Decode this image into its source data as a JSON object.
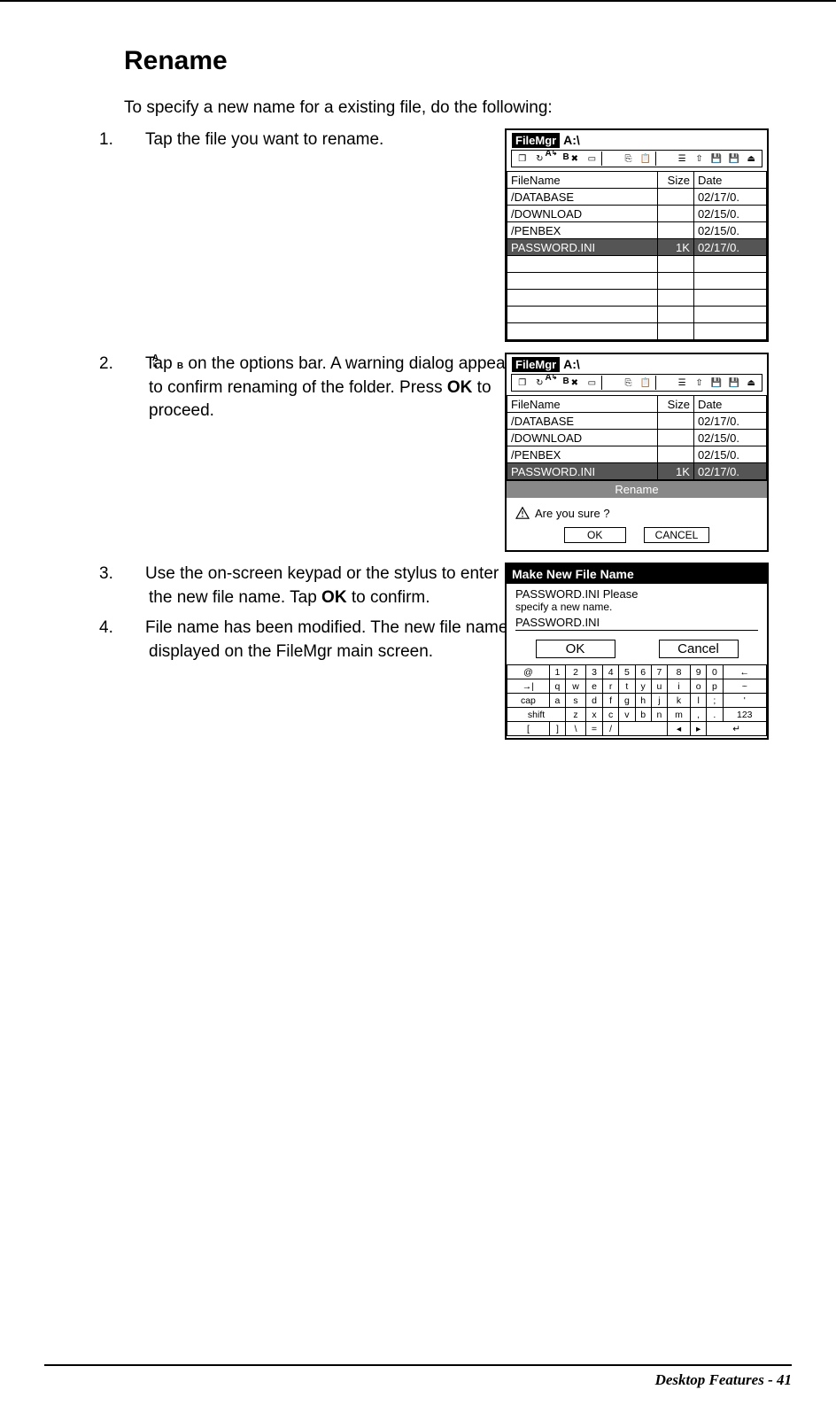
{
  "heading": "Rename",
  "intro": "To specify a new name for a existing file, do the following:",
  "steps": {
    "s1_num": "1.",
    "s1": "Tap the file you want to rename.",
    "s2_num": "2.",
    "s2_a": "Tap ",
    "s2_b": " on the options bar. A warning dialog appears to confirm renaming of the folder. Press ",
    "s2_ok": "OK",
    "s2_c": " to proceed.",
    "s3_num": "3.",
    "s3_a": "Use the on-screen keypad or the stylus to enter the new file name. Tap ",
    "s3_ok": "OK",
    "s3_b": " to con­firm.",
    "s4_num": "4.",
    "s4": "File name has been modified. The new file name is displayed on the FileMgr main screen."
  },
  "filemgr": {
    "title": "FileMgr",
    "path": "A:\\",
    "cols": {
      "name": "FileName",
      "size": "Size",
      "date": "Date"
    },
    "rows": [
      {
        "name": "/DATABASE",
        "size": "",
        "date": "02/17/0."
      },
      {
        "name": "/DOWNLOAD",
        "size": "",
        "date": "02/15/0."
      },
      {
        "name": "/PENBEX",
        "size": "",
        "date": "02/15/0."
      },
      {
        "name": "PASSWORD.INI",
        "size": "1K",
        "date": "02/17/0.",
        "selected": true
      }
    ]
  },
  "dialog": {
    "rename_label": "Rename",
    "msg": "Are you sure ?",
    "ok": "OK",
    "cancel": "CANCEL"
  },
  "makeNew": {
    "title": "Make New File Name",
    "line1": "PASSWORD.INI Please",
    "line2": "specify a new name.",
    "input": "PASSWORD.INI",
    "ok": "OK",
    "cancel": "Cancel"
  },
  "keyboard": {
    "r1": [
      "@",
      "1",
      "2",
      "3",
      "4",
      "5",
      "6",
      "7",
      "8",
      "9",
      "0",
      "←"
    ],
    "r2": [
      "→|",
      "q",
      "w",
      "e",
      "r",
      "t",
      "y",
      "u",
      "i",
      "o",
      "p",
      "~"
    ],
    "r3": [
      "cap",
      "a",
      "s",
      "d",
      "f",
      "g",
      "h",
      "j",
      "k",
      "l",
      ";",
      "'"
    ],
    "r4": [
      "shift",
      "z",
      "x",
      "c",
      "v",
      "b",
      "n",
      "m",
      ",",
      ".",
      "123"
    ],
    "r5": [
      "[",
      "]",
      "\\",
      "=",
      "/",
      "",
      "",
      "◂",
      "▸",
      "↵"
    ]
  },
  "footer": "Desktop Features - 41"
}
